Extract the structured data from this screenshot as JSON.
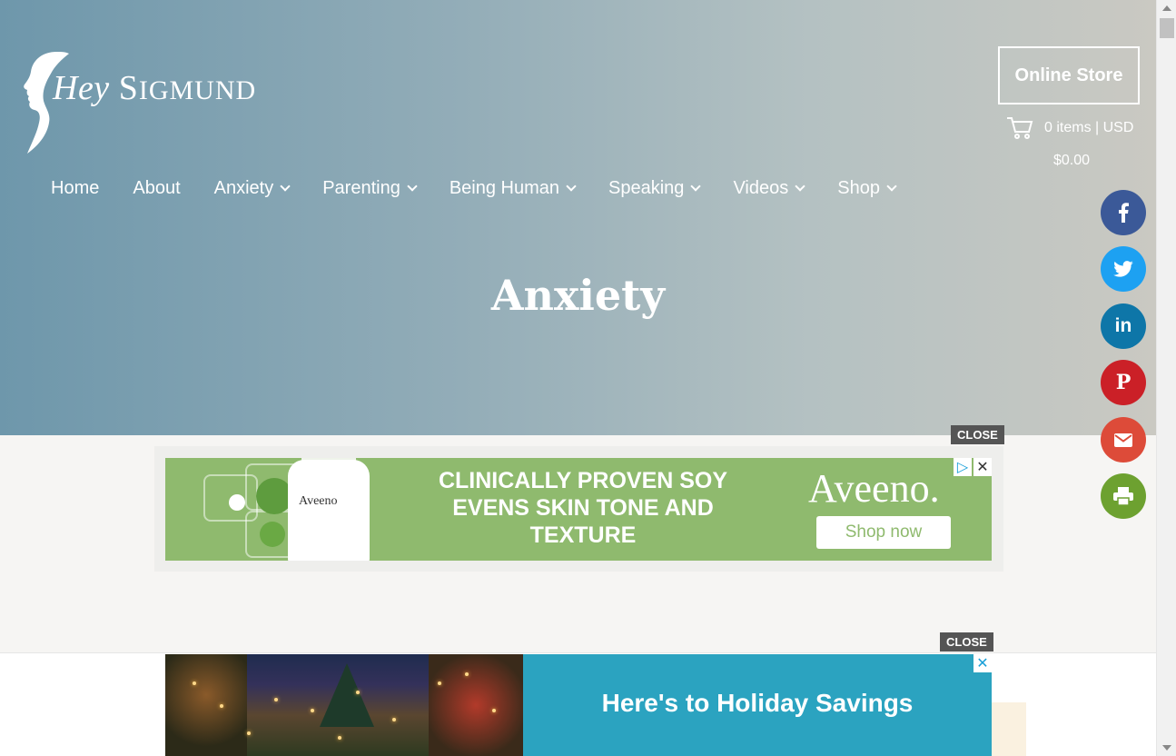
{
  "site": {
    "logo_hey": "Hey",
    "logo_sigmund_first": "S",
    "logo_sigmund_rest": "IGMUND"
  },
  "header": {
    "store_button": "Online Store",
    "cart_items": "0 items | USD",
    "cart_amount": "$0.00"
  },
  "nav": {
    "items": [
      {
        "label": "Home",
        "dropdown": false
      },
      {
        "label": "About",
        "dropdown": false
      },
      {
        "label": "Anxiety",
        "dropdown": true
      },
      {
        "label": "Parenting",
        "dropdown": true
      },
      {
        "label": "Being Human",
        "dropdown": true
      },
      {
        "label": "Speaking",
        "dropdown": true
      },
      {
        "label": "Videos",
        "dropdown": true
      },
      {
        "label": "Shop",
        "dropdown": true
      }
    ]
  },
  "page": {
    "title": "Anxiety"
  },
  "social": [
    {
      "name": "facebook",
      "glyph": "f",
      "color": "#3b5998"
    },
    {
      "name": "twitter",
      "glyph": "t",
      "color": "#1da1f2"
    },
    {
      "name": "linkedin",
      "glyph": "in",
      "color": "#0e76a8"
    },
    {
      "name": "pinterest",
      "glyph": "P",
      "color": "#cb2027"
    },
    {
      "name": "email",
      "glyph": "✉",
      "color": "#dd4b39"
    },
    {
      "name": "print",
      "glyph": "⎙",
      "color": "#6da130"
    }
  ],
  "ads": {
    "close_label": "CLOSE",
    "ad1": {
      "headline": "CLINICALLY PROVEN SOY EVENS SKIN TONE AND TEXTURE",
      "brand": "Aveeno.",
      "bottle_label": "Aveeno",
      "cta": "Shop now",
      "color": "#8fba6e"
    },
    "ad2": {
      "headline": "Here's to Holiday Savings",
      "color": "#2ba3c0"
    }
  }
}
